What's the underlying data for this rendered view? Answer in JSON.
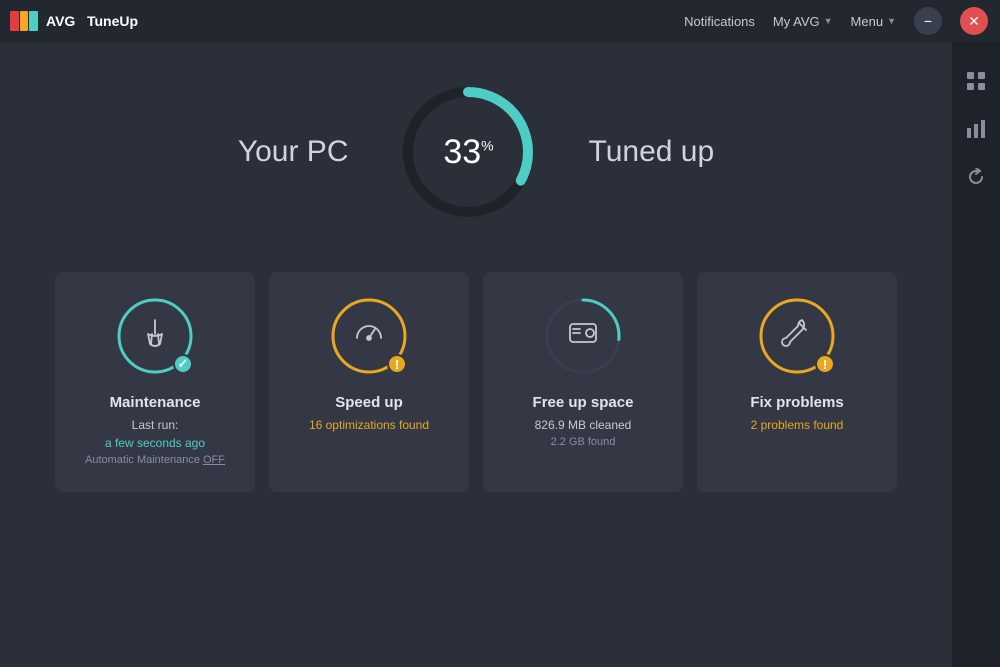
{
  "app": {
    "logo_text": "TuneUp",
    "logo_prefix": "AVG"
  },
  "titlebar": {
    "notifications": "Notifications",
    "my_avg": "My AVG",
    "menu": "Menu",
    "minimize": "−",
    "close": "✕"
  },
  "sidebar": {
    "icons": [
      "apps",
      "bar-chart",
      "refresh"
    ]
  },
  "score": {
    "label_left": "Your PC",
    "label_right": "Tuned up",
    "percent": "33",
    "percent_symbol": "%"
  },
  "cards": [
    {
      "id": "maintenance",
      "title": "Maintenance",
      "badge_type": "check",
      "sub_line1": "Last run:",
      "sub_line2": "a few seconds ago",
      "sub_line3_prefix": "Automatic Maintenance ",
      "sub_line3_link": "OFF",
      "ring_color": "#4ecdc4"
    },
    {
      "id": "speed-up",
      "title": "Speed up",
      "badge_type": "warn",
      "sub_line1": "16 optimizations found",
      "ring_color": "#e8a820"
    },
    {
      "id": "free-space",
      "title": "Free up space",
      "badge_type": null,
      "sub_line1": "826.9 MB cleaned",
      "sub_line2": "2.2 GB found",
      "ring_color": "#4ecdc4"
    },
    {
      "id": "fix-problems",
      "title": "Fix problems",
      "badge_type": "warn",
      "sub_line1": "2 problems found",
      "ring_color": "#e8a820"
    }
  ]
}
